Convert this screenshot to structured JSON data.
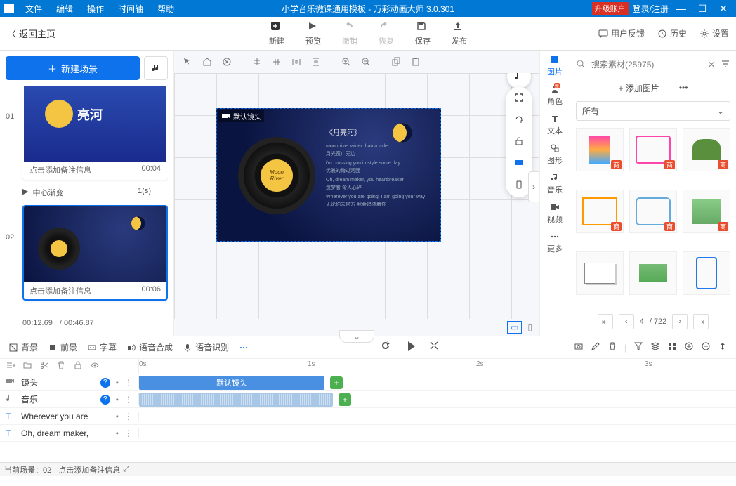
{
  "titlebar": {
    "menus": [
      "文件",
      "编辑",
      "操作",
      "时间轴",
      "帮助"
    ],
    "center": "小学音乐微课通用模板 - 万彩动画大师 3.0.301",
    "upgrade": "升级账户",
    "login": "登录/注册"
  },
  "toolbar": {
    "back": "返回主页",
    "new": "新建",
    "preview": "预览",
    "undo": "撤销",
    "redo": "恢复",
    "save": "保存",
    "publish": "发布",
    "feedback": "用户反馈",
    "history": "历史",
    "settings": "设置"
  },
  "left": {
    "new_scene": "新建场景",
    "scenes": [
      {
        "idx": "01",
        "note": "点击添加备注信息",
        "time": "00:04"
      },
      {
        "idx": "02",
        "note": "点击添加备注信息",
        "time": "00:06"
      }
    ],
    "transition": {
      "play": "▶",
      "name": "中心渐变",
      "dur": "1(s)"
    },
    "elapsed": "00:12.69",
    "total": "/ 00:46.87"
  },
  "canvas": {
    "default_cam": "默认镜头",
    "song_title": "《月亮河》",
    "disc_l1": "Moon",
    "disc_l2": "River",
    "ly1": "moon river wider than a mile",
    "ly2": "月光宽广无边",
    "ly3": "i'm crossing you in style some day",
    "ly4": "优雅的跨过河面",
    "ly5": "Oh, dream maker, you heartbreaker",
    "ly6": "造梦者 令人心碎",
    "ly7": "Wherever you are going, I am going your way",
    "ly8": "无论你去何方 我会追随着你"
  },
  "side_tabs": {
    "image": "图片",
    "role": "角色",
    "text": "文本",
    "shape": "图形",
    "music": "音乐",
    "video": "视频",
    "more": "更多",
    "role_badge": "新"
  },
  "assets": {
    "search_ph": "搜索素材(25975)",
    "add": "+ 添加图片",
    "more": "•••",
    "category": "所有",
    "badge": "商",
    "page": "4",
    "total": "/ 722"
  },
  "tlbar": {
    "bg": "背景",
    "fg": "前景",
    "sub": "字幕",
    "tts": "语音合成",
    "asr": "语音识别"
  },
  "ruler": {
    "t0": "0s",
    "t1": "1s",
    "t2": "2s",
    "t3": "3s"
  },
  "tracks": {
    "cam": "镜头",
    "cam_clip": "默认镜头",
    "music": "音乐",
    "text1": "Wherever you are",
    "text2": "Oh, dream maker,"
  },
  "status": {
    "scene": "当前场景：02",
    "note": "点击添加备注信息"
  }
}
